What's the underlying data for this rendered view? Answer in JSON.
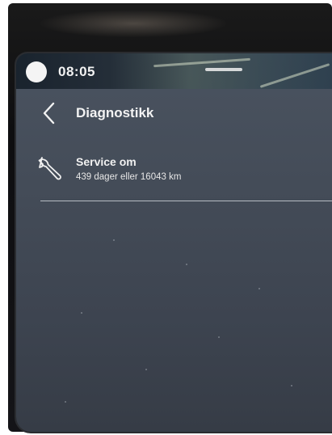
{
  "status_bar": {
    "time": "08:05"
  },
  "header": {
    "title": "Diagnostikk"
  },
  "service": {
    "label": "Service om",
    "detail": "439 dager eller 16043 km"
  },
  "colors": {
    "screen_bg": "#444c58",
    "text": "#f3f3f3",
    "divider": "#dce1e6"
  },
  "icons": {
    "back": "chevron-left-icon",
    "service": "wrench-icon",
    "profile": "profile-avatar"
  }
}
